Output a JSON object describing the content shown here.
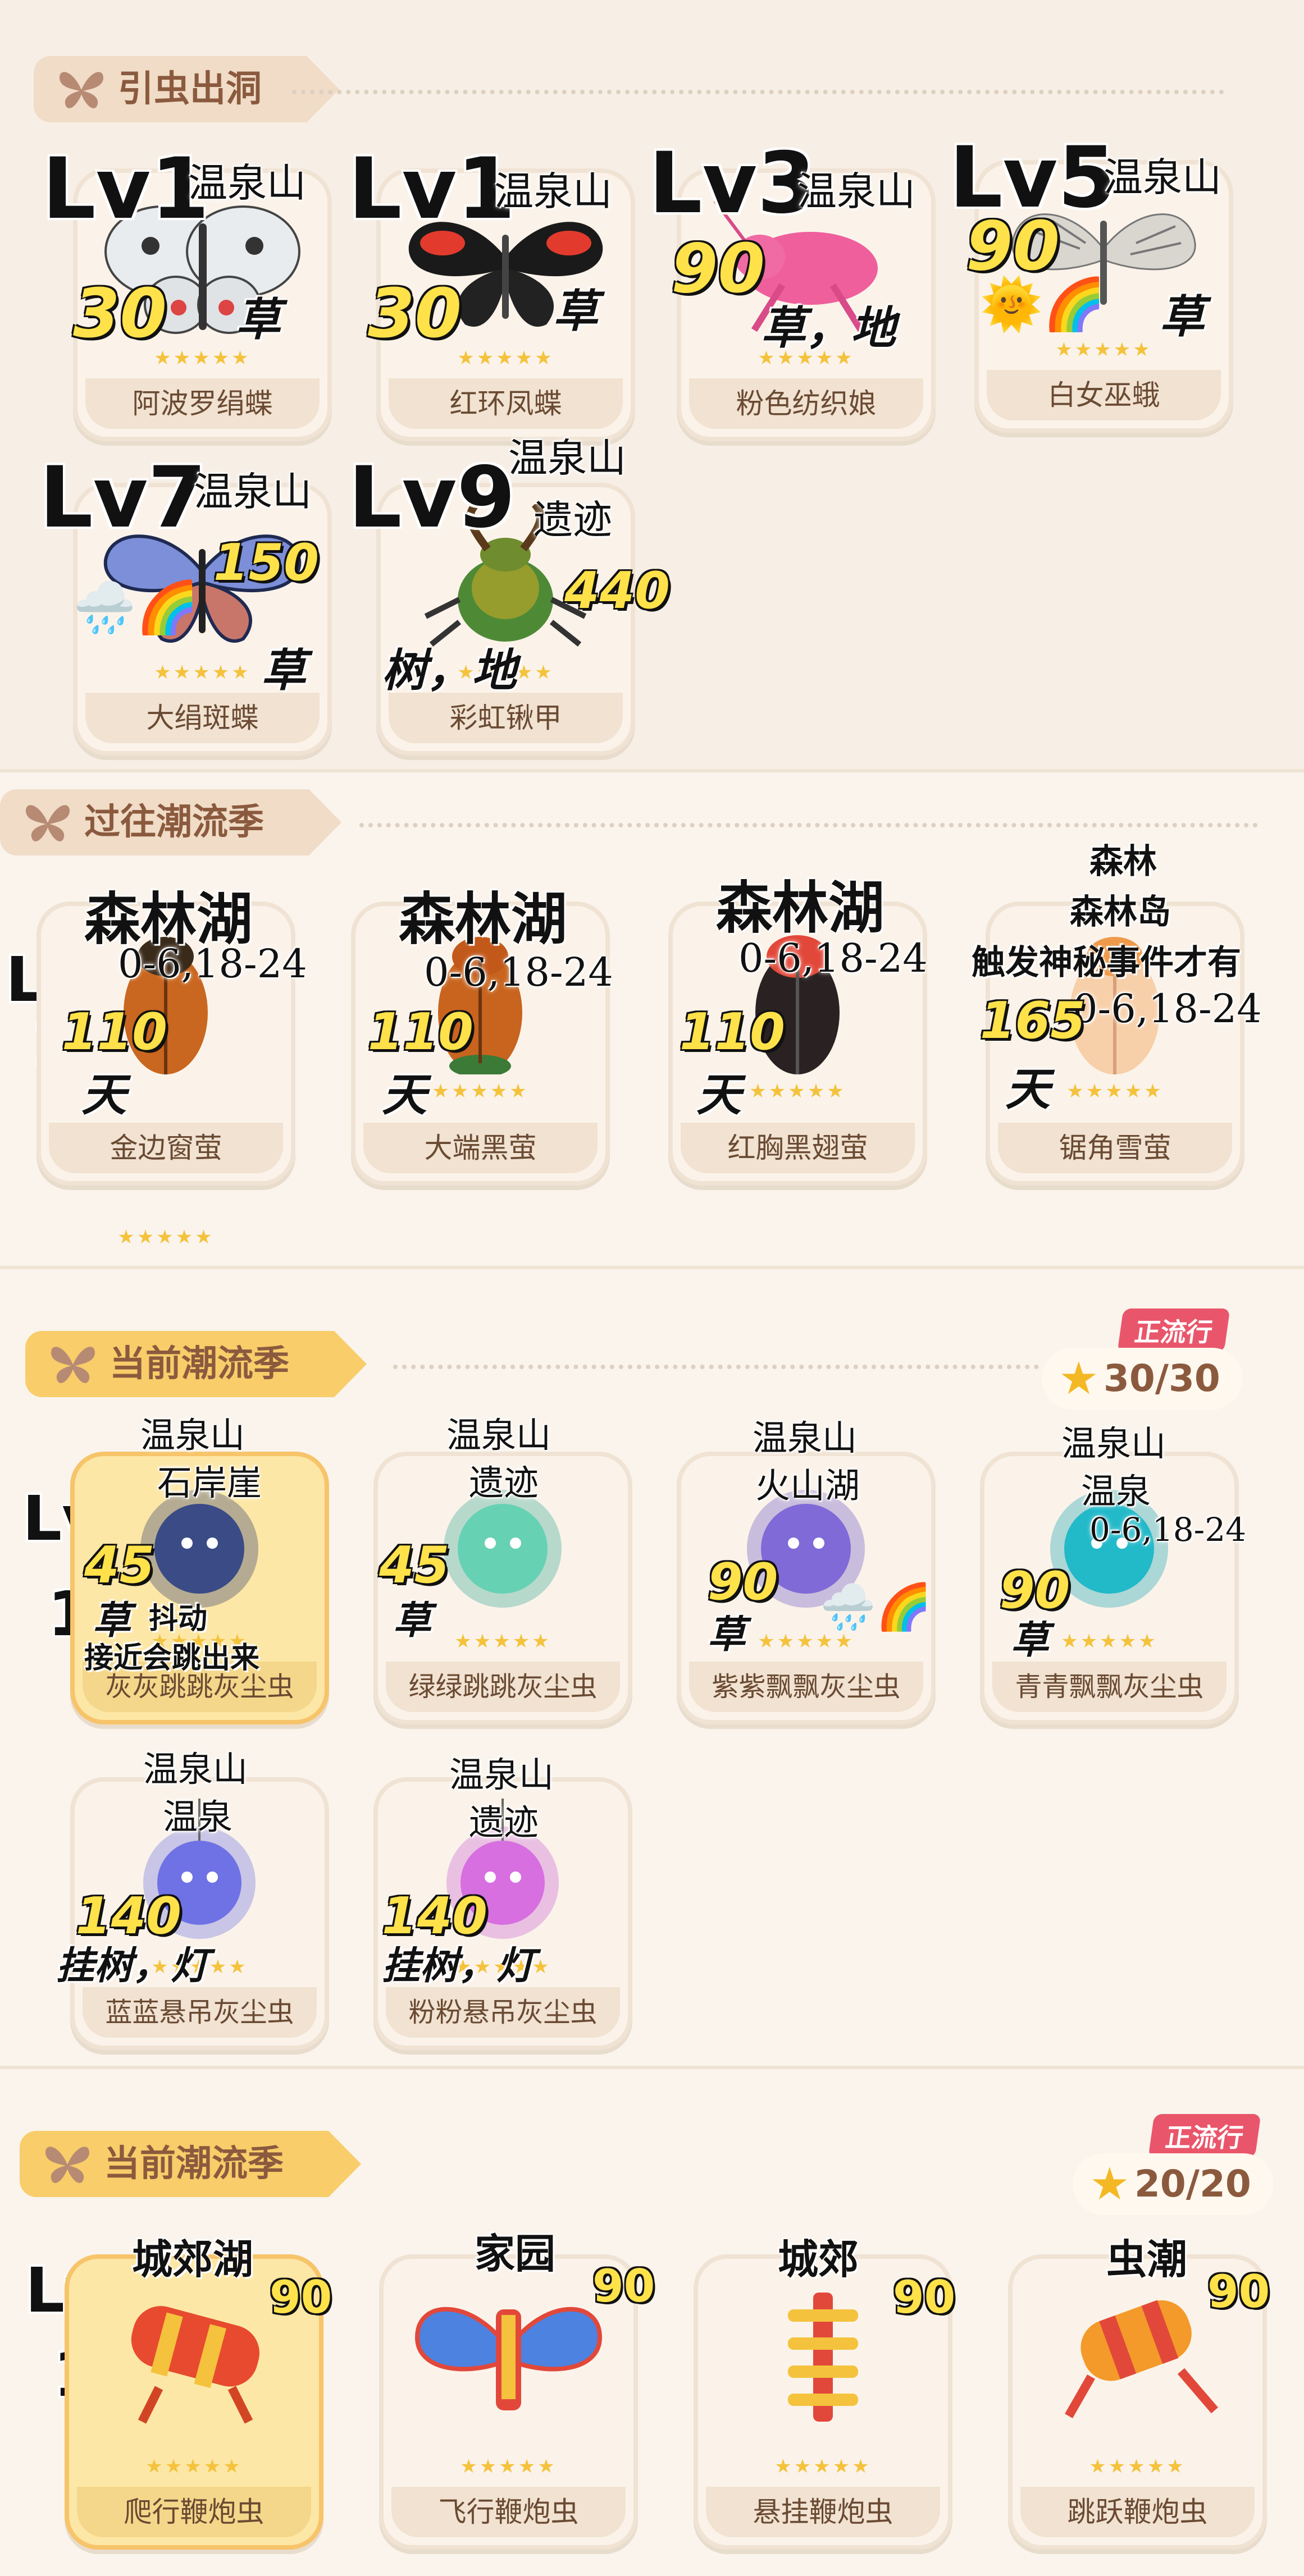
{
  "sec1": {
    "title": "引虫出洞",
    "cards": [
      {
        "name": "阿波罗绢蝶",
        "lv": "Lv1",
        "num": "30",
        "loc": "温泉山",
        "hab": "草"
      },
      {
        "name": "红环凤蝶",
        "lv": "Lv1",
        "num": "30",
        "loc": "温泉山",
        "hab": "草"
      },
      {
        "name": "粉色纺织娘",
        "lv": "Lv3",
        "num": "90",
        "loc": "温泉山",
        "hab": "草，地"
      },
      {
        "name": "白女巫蛾",
        "lv": "Lv5",
        "num": "90",
        "loc": "温泉山",
        "hab": "草"
      },
      {
        "name": "大绢斑蝶",
        "lv": "Lv7",
        "num": "150",
        "loc": "温泉山",
        "hab": "草"
      },
      {
        "name": "彩虹锹甲",
        "lv": "Lv9",
        "num": "440",
        "loc": "温泉山",
        "loc2": "遗迹",
        "hab": "树，地"
      }
    ]
  },
  "sec2": {
    "title": "过往潮流季",
    "lv": "Lv",
    "lvnum": "1",
    "cards": [
      {
        "name": "金边窗萤",
        "loc": "森林湖",
        "time": "0-6,18-24",
        "num": "110",
        "hab": "天"
      },
      {
        "name": "大端黑萤",
        "loc": "森林湖",
        "time": "0-6,18-24",
        "num": "110",
        "hab": "天"
      },
      {
        "name": "红胸黑翅萤",
        "loc": "森林湖",
        "time": "0-6,18-24",
        "num": "110",
        "hab": "天"
      },
      {
        "name": "锯角雪萤",
        "loc": "森林",
        "loc2": "森林岛",
        "loc3": "触发神秘事件才有",
        "time": "0-6,18-24",
        "num": "165",
        "hab": "天"
      }
    ]
  },
  "sec3": {
    "title": "当前潮流季",
    "badge": "正流行",
    "count": "30/30",
    "lv": "Lv",
    "lvnum": "1",
    "cards": [
      {
        "name": "灰灰跳跳灰尘虫",
        "loc": "温泉山",
        "loc2": "石岸崖",
        "num": "45",
        "hab": "草",
        "note1": "抖动",
        "note2": "接近会跳出来"
      },
      {
        "name": "绿绿跳跳灰尘虫",
        "loc": "温泉山",
        "loc2": "遗迹",
        "num": "45",
        "hab": "草"
      },
      {
        "name": "紫紫飘飘灰尘虫",
        "loc": "温泉山",
        "loc2": "火山湖",
        "num": "90",
        "hab": "草"
      },
      {
        "name": "青青飘飘灰尘虫",
        "loc": "温泉山",
        "loc2": "温泉",
        "time": "0-6,18-24",
        "num": "90",
        "hab": "草"
      },
      {
        "name": "蓝蓝悬吊灰尘虫",
        "loc": "温泉山",
        "loc2": "温泉",
        "num": "140",
        "hab": "挂树，灯"
      },
      {
        "name": "粉粉悬吊灰尘虫",
        "loc": "温泉山",
        "loc2": "遗迹",
        "num": "140",
        "hab": "挂树，灯"
      }
    ]
  },
  "sec4": {
    "title": "当前潮流季",
    "badge": "正流行",
    "count": "20/20",
    "lv": "Lv",
    "lvnum": "1",
    "cards": [
      {
        "name": "爬行鞭炮虫",
        "loc": "城郊湖",
        "num": "90"
      },
      {
        "name": "飞行鞭炮虫",
        "loc": "家园",
        "num": "90"
      },
      {
        "name": "悬挂鞭炮虫",
        "loc": "城郊",
        "num": "90"
      },
      {
        "name": "跳跃鞭炮虫",
        "loc": "虫潮",
        "num": "90"
      }
    ]
  },
  "stars": "★★★★★",
  "colors": {
    "accent": "#f8cd6a",
    "badge": "#e9566b",
    "star": "#f4c23c",
    "number": "#ffe24a"
  }
}
